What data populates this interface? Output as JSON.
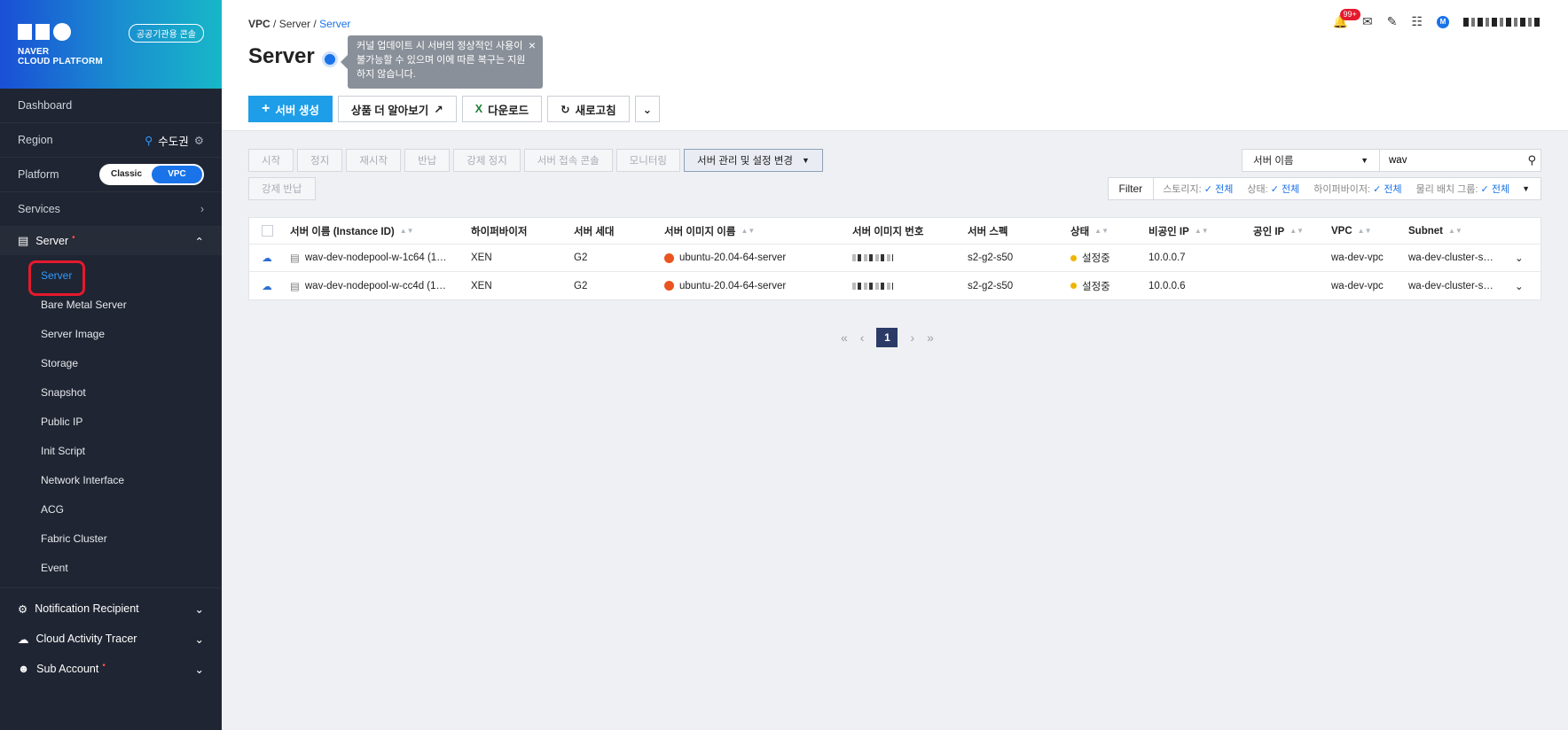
{
  "brand": {
    "logo_line1": "NAVER",
    "logo_line2": "CLOUD PLATFORM",
    "public_console_label": "공공기관용 콘솔"
  },
  "sidebar": {
    "dashboard": "Dashboard",
    "region_label": "Region",
    "region_value": "수도권",
    "platform_label": "Platform",
    "platform_options": [
      "Classic",
      "VPC"
    ],
    "platform_selected": "VPC",
    "services": "Services",
    "server_group": "Server",
    "server_items": [
      "Server",
      "Bare Metal Server",
      "Server Image",
      "Storage",
      "Snapshot",
      "Public IP",
      "Init Script",
      "Network Interface",
      "ACG",
      "Fabric Cluster",
      "Event"
    ],
    "active_item": "Server",
    "bottom_groups": [
      "Notification Recipient",
      "Cloud Activity Tracer",
      "Sub Account"
    ]
  },
  "header": {
    "breadcrumb": [
      "VPC",
      "Server",
      "Server"
    ],
    "title": "Server",
    "tooltip": "커널 업데이트 시 서버의 정상적인 사용이 불가능할 수 있으며 이에 따른 복구는 지원하지 않습니다.",
    "notification_badge": "99+",
    "user_initial": "M"
  },
  "toolbar": {
    "create": "서버 생성",
    "learn_more": "상품 더 알아보기",
    "download": "다운로드",
    "refresh": "새로고침"
  },
  "actions": {
    "buttons": [
      "시작",
      "정지",
      "재시작",
      "반납",
      "강제 정지",
      "서버 접속 콘솔",
      "모니터링"
    ],
    "manage": "서버 관리 및 설정 변경",
    "force_return": "강제 반납"
  },
  "search": {
    "field": "서버 이름",
    "value": "wav"
  },
  "filter": {
    "label": "Filter",
    "items": [
      {
        "name": "스토리지:",
        "value": "전체"
      },
      {
        "name": "상태:",
        "value": "전체"
      },
      {
        "name": "하이퍼바이저:",
        "value": "전체"
      },
      {
        "name": "물리 배치 그룹:",
        "value": "전체"
      }
    ]
  },
  "table": {
    "headers": [
      "서버 이름 (Instance ID)",
      "하이퍼바이저",
      "서버 세대",
      "서버 이미지 이름",
      "서버 이미지 번호",
      "서버 스펙",
      "상태",
      "비공인 IP",
      "공인 IP",
      "VPC",
      "Subnet"
    ],
    "rows": [
      {
        "name": "wav-dev-nodepool-w-1c64 (1…",
        "hypervisor": "XEN",
        "generation": "G2",
        "image": "ubuntu-20.04-64-server",
        "spec": "s2-g2-s50",
        "status": "설정중",
        "private_ip": "10.0.0.7",
        "public_ip": "",
        "vpc": "wa-dev-vpc",
        "subnet": "wa-dev-cluster-s…"
      },
      {
        "name": "wav-dev-nodepool-w-cc4d (1…",
        "hypervisor": "XEN",
        "generation": "G2",
        "image": "ubuntu-20.04-64-server",
        "spec": "s2-g2-s50",
        "status": "설정중",
        "private_ip": "10.0.0.6",
        "public_ip": "",
        "vpc": "wa-dev-vpc",
        "subnet": "wa-dev-cluster-s…"
      }
    ]
  },
  "pagination": {
    "current": "1"
  },
  "colors": {
    "accent": "#1a73e8",
    "primary_button": "#1e9ee8",
    "sidebar_bg": "#1f2532",
    "status_setting": "#f0b400",
    "highlight_ring": "#e5192d"
  }
}
